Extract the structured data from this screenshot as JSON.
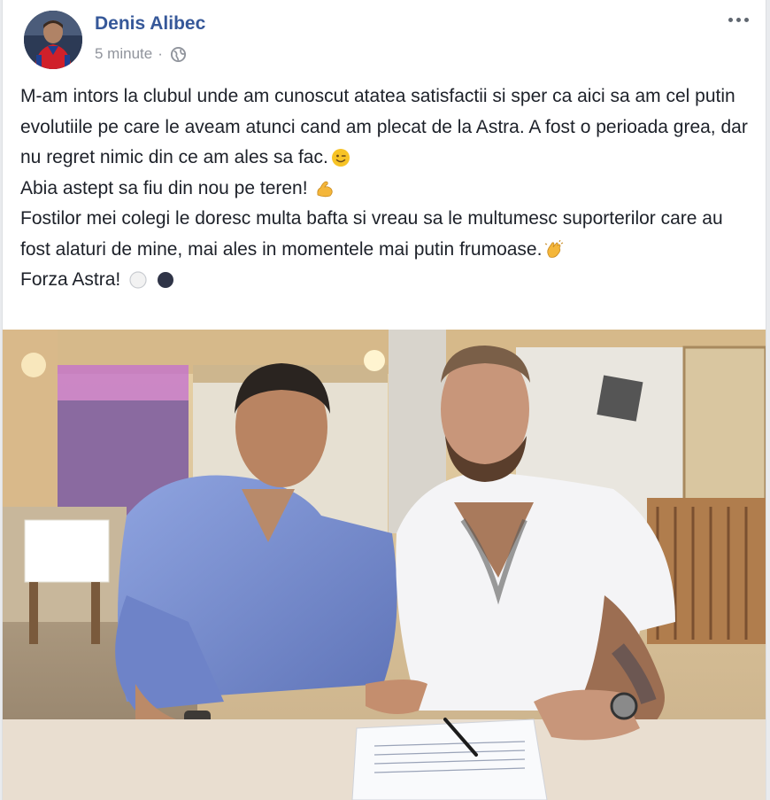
{
  "post": {
    "author": "Denis Alibec",
    "time": "5 minute",
    "lines": [
      "M-am intors la clubul unde am cunoscut atatea satisfactii si sper ca aici sa am cel putin evolutiile pe care le aveam atunci cand am plecat de la Astra. A fost o perioada grea, dar nu regret nimic din ce am ales sa fac.",
      "Abia astept sa fiu din nou pe teren!",
      "Fostilor mei colegi le doresc multa bafta si vreau sa le multumesc suporterilor care au fost alaturi de mine, mai ales in momentele mai putin frumoase.",
      "Forza Astra!"
    ],
    "icons": {
      "more": "more-options-icon",
      "audience": "globe-icon",
      "emoji_line1": "winking-face-emoji",
      "emoji_line2": "flexed-biceps-emoji",
      "emoji_line3": "clapping-hands-emoji",
      "emoji_line4": [
        "white-circle-emoji",
        "black-circle-emoji"
      ]
    }
  },
  "colors": {
    "author": "#365899",
    "meta": "#90949c",
    "text": "#1d2129"
  }
}
